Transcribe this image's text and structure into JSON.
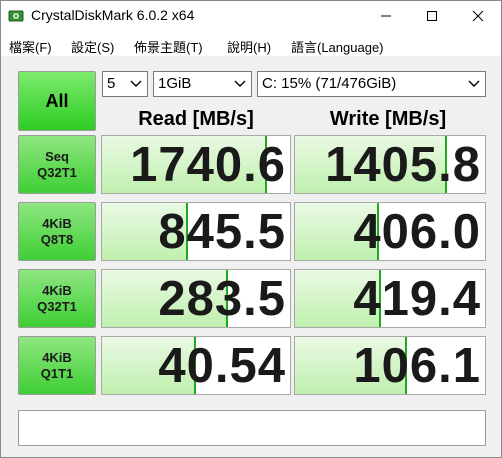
{
  "window": {
    "title": "CrystalDiskMark 6.0.2 x64"
  },
  "menu": [
    {
      "label": "檔案(F)"
    },
    {
      "label": "設定(S)"
    },
    {
      "label": "佈景主題(T)"
    },
    {
      "label": "說明(H)"
    },
    {
      "label": "語言(Language)"
    }
  ],
  "controls": {
    "all_label": "All",
    "count_value": "5",
    "size_value": "1GiB",
    "drive_value": "C: 15% (71/476GiB)"
  },
  "headers": {
    "read": "Read [MB/s]",
    "write": "Write [MB/s]"
  },
  "tests": [
    {
      "line1": "Seq",
      "line2": "Q32T1",
      "read": "1740.6",
      "write": "1405.8",
      "read_fill": 0.88,
      "write_fill": 0.8
    },
    {
      "line1": "4KiB",
      "line2": "Q8T8",
      "read": "845.5",
      "write": "406.0",
      "read_fill": 0.46,
      "write_fill": 0.44
    },
    {
      "line1": "4KiB",
      "line2": "Q32T1",
      "read": "283.5",
      "write": "419.4",
      "read_fill": 0.67,
      "write_fill": 0.45
    },
    {
      "line1": "4KiB",
      "line2": "Q1T1",
      "read": "40.54",
      "write": "106.1",
      "read_fill": 0.5,
      "write_fill": 0.59
    }
  ],
  "comment": "",
  "colors": {
    "accent_green": "#2ecc22",
    "bar_edge": "#1ea91e"
  }
}
